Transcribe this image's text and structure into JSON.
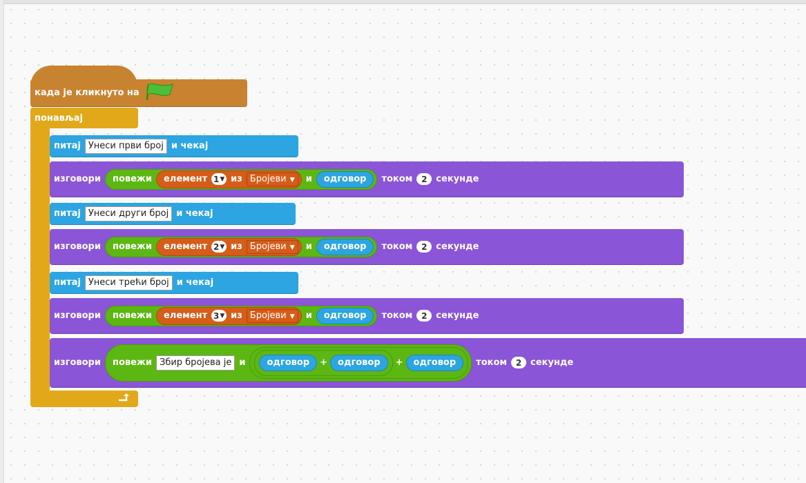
{
  "script": {
    "hat": {
      "label": "када је кликнуто на",
      "icon": "green-flag-icon"
    },
    "repeat": {
      "label": "понављај",
      "loop_icon": "loop-arrow-icon"
    },
    "ask1": {
      "label": "питај",
      "text": "Унеси први број",
      "wait": "и чекај"
    },
    "say1": {
      "say": "изговори",
      "join": "повежи",
      "item": "елемент",
      "index": "1",
      "of": "из",
      "list": "Бројеви",
      "and": "и",
      "answer": "одговор",
      "for": "током",
      "secs": "2",
      "seconds": "секунде"
    },
    "ask2": {
      "label": "питај",
      "text": "Унеси други број",
      "wait": "и чекај"
    },
    "say2": {
      "say": "изговори",
      "join": "повежи",
      "item": "елемент",
      "index": "2",
      "of": "из",
      "list": "Бројеви",
      "and": "и",
      "answer": "одговор",
      "for": "током",
      "secs": "2",
      "seconds": "секунде"
    },
    "ask3": {
      "label": "питај",
      "text": "Унеси трећи број",
      "wait": "и чекај"
    },
    "say3": {
      "say": "изговори",
      "join": "повежи",
      "item": "елемент",
      "index": "3",
      "of": "из",
      "list": "Бројеви",
      "and": "и",
      "answer": "одговор",
      "for": "током",
      "secs": "2",
      "seconds": "секунде"
    },
    "say4": {
      "say": "изговори",
      "join": "повежи",
      "text": "Збир бројева је",
      "and": "и",
      "answer1": "одговор",
      "plus1": "+",
      "answer2": "одговор",
      "plus2": "+",
      "answer3": "одговор",
      "for": "током",
      "secs": "2",
      "seconds": "секунде"
    }
  },
  "colors": {
    "events": "#c88330",
    "control": "#e1a91a",
    "sensing": "#2ca5e2",
    "looks": "#8a55d7",
    "operators": "#5cb712",
    "data": "#d65c19"
  }
}
